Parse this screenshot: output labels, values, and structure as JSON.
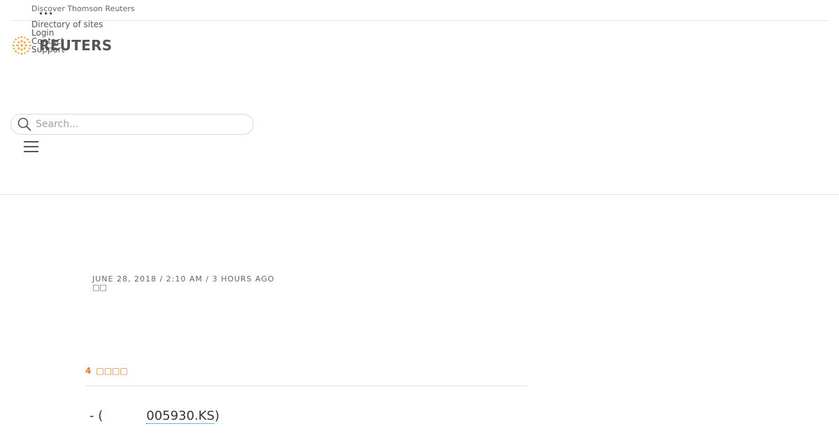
{
  "utility": {
    "discover": "Discover Thomson Reuters",
    "directory": "Directory of sites",
    "login": "Login",
    "contact": "Contact",
    "support": "Support",
    "dots": "•••"
  },
  "brand": {
    "logo_text": "REUTERS",
    "accent": "#f39a1d"
  },
  "search": {
    "placeholder": "Search..."
  },
  "article": {
    "dateline": "JUNE 28, 2018 / 2:10 AM / 3 HOURS AGO",
    "byline": "□□",
    "min_read_number": "4",
    "min_read_label": "□□□□",
    "lede_prefix": "- (",
    "ticker": "005930.KS",
    "lede_suffix": ")"
  }
}
